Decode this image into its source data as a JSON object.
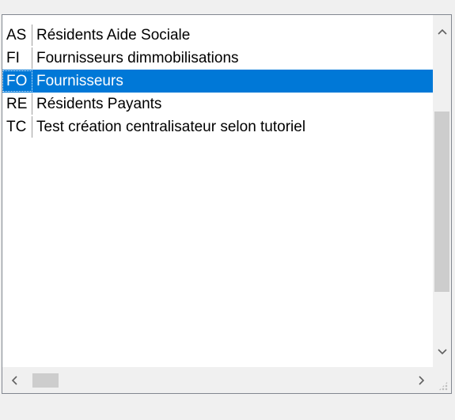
{
  "list": {
    "rows": [
      {
        "code": "AS",
        "label": "Résidents Aide Sociale",
        "selected": false
      },
      {
        "code": "FI",
        "label": "Fournisseurs dimmobilisations",
        "selected": false
      },
      {
        "code": "FO",
        "label": "Fournisseurs",
        "selected": true
      },
      {
        "code": "RE",
        "label": "Résidents Payants",
        "selected": false
      },
      {
        "code": "TC",
        "label": "Test création centralisateur selon tutoriel",
        "selected": false
      }
    ]
  },
  "icons": {
    "scroll_up": "chevron-up-icon",
    "scroll_down": "chevron-down-icon",
    "scroll_left": "chevron-left-icon",
    "scroll_right": "chevron-right-icon",
    "resize_grip": "resize-grip-icon"
  },
  "colors": {
    "selection": "#0078d7",
    "selection_text": "#ffffff",
    "border": "#828790",
    "scroll_thumb": "#cdcdcd"
  }
}
